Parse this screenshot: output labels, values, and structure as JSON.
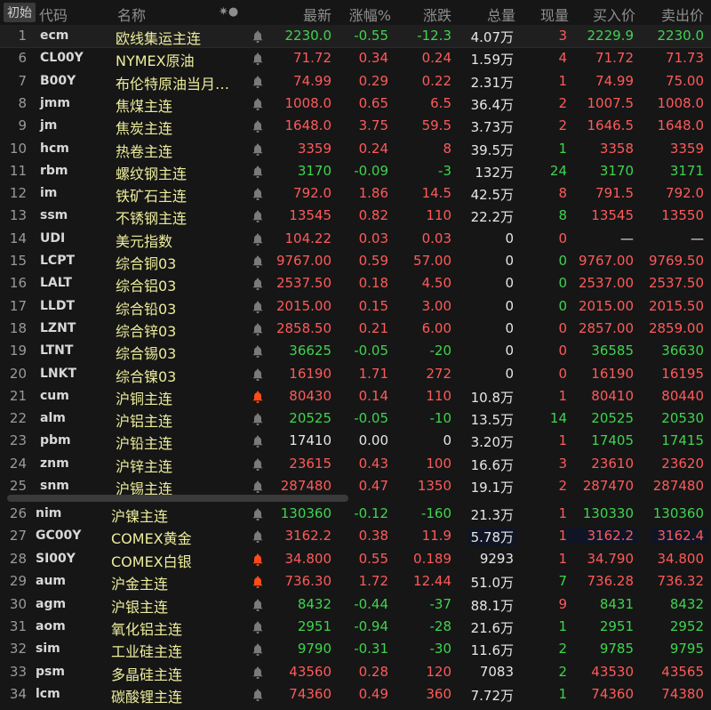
{
  "header": {
    "tab": "初始",
    "code": "代码",
    "name": "名称",
    "icons": "✷●",
    "last": "最新",
    "pct": "涨幅%",
    "chg": "涨跌",
    "vol": "总量",
    "cur": "现量",
    "bid": "买入价",
    "ask": "卖出价"
  },
  "colors": {
    "up": "#ff5a5a",
    "down": "#3fd44f",
    "flat": "#e6e6e6",
    "name": "#ecec9c",
    "alert_active": "#ff4a1a",
    "alert_idle": "#7a7a7a"
  },
  "rows": [
    {
      "n": "1",
      "code": "ecm",
      "name": "欧线集运主连",
      "last": "2230.0",
      "pct": "-0.55",
      "chg": "-12.3",
      "vol": "4.07万",
      "cur": "3",
      "bid": "2229.9",
      "ask": "2230.0",
      "c": "G",
      "qc": "R",
      "bc": "G",
      "alert": false
    },
    {
      "n": "6",
      "code": "CL00Y",
      "name": "NYMEX原油",
      "last": "71.72",
      "pct": "0.34",
      "chg": "0.24",
      "vol": "1.59万",
      "cur": "4",
      "bid": "71.72",
      "ask": "71.73",
      "c": "R",
      "qc": "R",
      "bc": "R",
      "alert": false
    },
    {
      "n": "7",
      "code": "B00Y",
      "name": "布伦特原油当月…",
      "last": "74.99",
      "pct": "0.29",
      "chg": "0.22",
      "vol": "2.31万",
      "cur": "1",
      "bid": "74.99",
      "ask": "75.00",
      "c": "R",
      "qc": "R",
      "bc": "R",
      "alert": false
    },
    {
      "n": "8",
      "code": "jmm",
      "name": "焦煤主连",
      "last": "1008.0",
      "pct": "0.65",
      "chg": "6.5",
      "vol": "36.4万",
      "cur": "2",
      "bid": "1007.5",
      "ask": "1008.0",
      "c": "R",
      "qc": "R",
      "bc": "R",
      "alert": false
    },
    {
      "n": "9",
      "code": "jm",
      "name": "焦炭主连",
      "last": "1648.0",
      "pct": "3.75",
      "chg": "59.5",
      "vol": "3.73万",
      "cur": "2",
      "bid": "1646.5",
      "ask": "1648.0",
      "c": "R",
      "qc": "R",
      "bc": "R",
      "alert": false
    },
    {
      "n": "10",
      "code": "hcm",
      "name": "热卷主连",
      "last": "3359",
      "pct": "0.24",
      "chg": "8",
      "vol": "39.5万",
      "cur": "1",
      "bid": "3358",
      "ask": "3359",
      "c": "R",
      "qc": "G",
      "bc": "R",
      "alert": false
    },
    {
      "n": "11",
      "code": "rbm",
      "name": "螺纹钢主连",
      "last": "3170",
      "pct": "-0.09",
      "chg": "-3",
      "vol": "132万",
      "cur": "24",
      "bid": "3170",
      "ask": "3171",
      "c": "G",
      "qc": "G",
      "bc": "G",
      "alert": false
    },
    {
      "n": "12",
      "code": "im",
      "name": "铁矿石主连",
      "last": "792.0",
      "pct": "1.86",
      "chg": "14.5",
      "vol": "42.5万",
      "cur": "8",
      "bid": "791.5",
      "ask": "792.0",
      "c": "R",
      "qc": "R",
      "bc": "R",
      "alert": false
    },
    {
      "n": "13",
      "code": "ssm",
      "name": "不锈钢主连",
      "last": "13545",
      "pct": "0.82",
      "chg": "110",
      "vol": "22.2万",
      "cur": "8",
      "bid": "13545",
      "ask": "13550",
      "c": "R",
      "qc": "G",
      "bc": "R",
      "alert": false
    },
    {
      "n": "14",
      "code": "UDI",
      "name": "美元指数",
      "last": "104.22",
      "pct": "0.03",
      "chg": "0.03",
      "vol": "0",
      "cur": "0",
      "bid": "—",
      "ask": "—",
      "c": "R",
      "qc": "R",
      "bc": "W",
      "alert": false
    },
    {
      "n": "15",
      "code": "LCPT",
      "name": "综合铜03",
      "last": "9767.00",
      "pct": "0.59",
      "chg": "57.00",
      "vol": "0",
      "cur": "0",
      "bid": "9767.00",
      "ask": "9769.50",
      "c": "R",
      "qc": "G",
      "bc": "R",
      "alert": false
    },
    {
      "n": "16",
      "code": "LALT",
      "name": "综合铝03",
      "last": "2537.50",
      "pct": "0.18",
      "chg": "4.50",
      "vol": "0",
      "cur": "0",
      "bid": "2537.00",
      "ask": "2537.50",
      "c": "R",
      "qc": "G",
      "bc": "R",
      "alert": false
    },
    {
      "n": "17",
      "code": "LLDT",
      "name": "综合铅03",
      "last": "2015.00",
      "pct": "0.15",
      "chg": "3.00",
      "vol": "0",
      "cur": "0",
      "bid": "2015.00",
      "ask": "2015.50",
      "c": "R",
      "qc": "G",
      "bc": "R",
      "alert": false
    },
    {
      "n": "18",
      "code": "LZNT",
      "name": "综合锌03",
      "last": "2858.50",
      "pct": "0.21",
      "chg": "6.00",
      "vol": "0",
      "cur": "0",
      "bid": "2857.00",
      "ask": "2859.00",
      "c": "R",
      "qc": "R",
      "bc": "R",
      "alert": false
    },
    {
      "n": "19",
      "code": "LTNT",
      "name": "综合锡03",
      "last": "36625",
      "pct": "-0.05",
      "chg": "-20",
      "vol": "0",
      "cur": "0",
      "bid": "36585",
      "ask": "36630",
      "c": "G",
      "qc": "R",
      "bc": "G",
      "alert": false
    },
    {
      "n": "20",
      "code": "LNKT",
      "name": "综合镍03",
      "last": "16190",
      "pct": "1.71",
      "chg": "272",
      "vol": "0",
      "cur": "0",
      "bid": "16190",
      "ask": "16195",
      "c": "R",
      "qc": "R",
      "bc": "R",
      "alert": false
    },
    {
      "n": "21",
      "code": "cum",
      "name": "沪铜主连",
      "last": "80430",
      "pct": "0.14",
      "chg": "110",
      "vol": "10.8万",
      "cur": "1",
      "bid": "80410",
      "ask": "80440",
      "c": "R",
      "qc": "R",
      "bc": "R",
      "alert": true
    },
    {
      "n": "22",
      "code": "alm",
      "name": "沪铝主连",
      "last": "20525",
      "pct": "-0.05",
      "chg": "-10",
      "vol": "13.5万",
      "cur": "14",
      "bid": "20525",
      "ask": "20530",
      "c": "G",
      "qc": "G",
      "bc": "G",
      "alert": false
    },
    {
      "n": "23",
      "code": "pbm",
      "name": "沪铅主连",
      "last": "17410",
      "pct": "0.00",
      "chg": "0",
      "vol": "3.20万",
      "cur": "1",
      "bid": "17405",
      "ask": "17415",
      "c": "W",
      "qc": "R",
      "bc": "G",
      "alert": false
    },
    {
      "n": "24",
      "code": "znm",
      "name": "沪锌主连",
      "last": "23615",
      "pct": "0.43",
      "chg": "100",
      "vol": "16.6万",
      "cur": "3",
      "bid": "23610",
      "ask": "23620",
      "c": "R",
      "qc": "R",
      "bc": "R",
      "alert": false
    },
    {
      "n": "25",
      "code": "snm",
      "name": "沪锡主连",
      "last": "287480",
      "pct": "0.47",
      "chg": "1350",
      "vol": "19.1万",
      "cur": "2",
      "bid": "287470",
      "ask": "287480",
      "c": "R",
      "qc": "R",
      "bc": "R",
      "alert": false
    },
    {
      "n": "26",
      "code": "nim",
      "name": "沪镍主连",
      "last": "130360",
      "pct": "-0.12",
      "chg": "-160",
      "vol": "21.3万",
      "cur": "1",
      "bid": "130330",
      "ask": "130360",
      "c": "G",
      "qc": "R",
      "bc": "G",
      "alert": false
    },
    {
      "n": "27",
      "code": "GC00Y",
      "name": "COMEX黄金",
      "last": "3162.2",
      "pct": "0.38",
      "chg": "11.9",
      "vol": "5.78万",
      "cur": "1",
      "bid": "3162.2",
      "ask": "3162.4",
      "c": "R",
      "qc": "R",
      "bc": "R",
      "alert": false
    },
    {
      "n": "28",
      "code": "SI00Y",
      "name": "COMEX白银",
      "last": "34.800",
      "pct": "0.55",
      "chg": "0.189",
      "vol": "9293",
      "cur": "1",
      "bid": "34.790",
      "ask": "34.800",
      "c": "R",
      "qc": "R",
      "bc": "R",
      "alert": true
    },
    {
      "n": "29",
      "code": "aum",
      "name": "沪金主连",
      "last": "736.30",
      "pct": "1.72",
      "chg": "12.44",
      "vol": "51.0万",
      "cur": "7",
      "bid": "736.28",
      "ask": "736.32",
      "c": "R",
      "qc": "G",
      "bc": "R",
      "alert": true
    },
    {
      "n": "30",
      "code": "agm",
      "name": "沪银主连",
      "last": "8432",
      "pct": "-0.44",
      "chg": "-37",
      "vol": "88.1万",
      "cur": "9",
      "bid": "8431",
      "ask": "8432",
      "c": "G",
      "qc": "R",
      "bc": "G",
      "alert": false
    },
    {
      "n": "31",
      "code": "aom",
      "name": "氧化铝主连",
      "last": "2951",
      "pct": "-0.94",
      "chg": "-28",
      "vol": "21.6万",
      "cur": "1",
      "bid": "2951",
      "ask": "2952",
      "c": "G",
      "qc": "G",
      "bc": "G",
      "alert": false
    },
    {
      "n": "32",
      "code": "sim",
      "name": "工业硅主连",
      "last": "9790",
      "pct": "-0.31",
      "chg": "-30",
      "vol": "11.6万",
      "cur": "2",
      "bid": "9785",
      "ask": "9795",
      "c": "G",
      "qc": "G",
      "bc": "G",
      "alert": false
    },
    {
      "n": "33",
      "code": "psm",
      "name": "多晶硅主连",
      "last": "43560",
      "pct": "0.28",
      "chg": "120",
      "vol": "7083",
      "cur": "2",
      "bid": "43530",
      "ask": "43565",
      "c": "R",
      "qc": "G",
      "bc": "R",
      "alert": false
    },
    {
      "n": "34",
      "code": "lcm",
      "name": "碳酸锂主连",
      "last": "74360",
      "pct": "0.49",
      "chg": "360",
      "vol": "7.72万",
      "cur": "1",
      "bid": "74360",
      "ask": "74380",
      "c": "R",
      "qc": "G",
      "bc": "R",
      "alert": false
    }
  ]
}
